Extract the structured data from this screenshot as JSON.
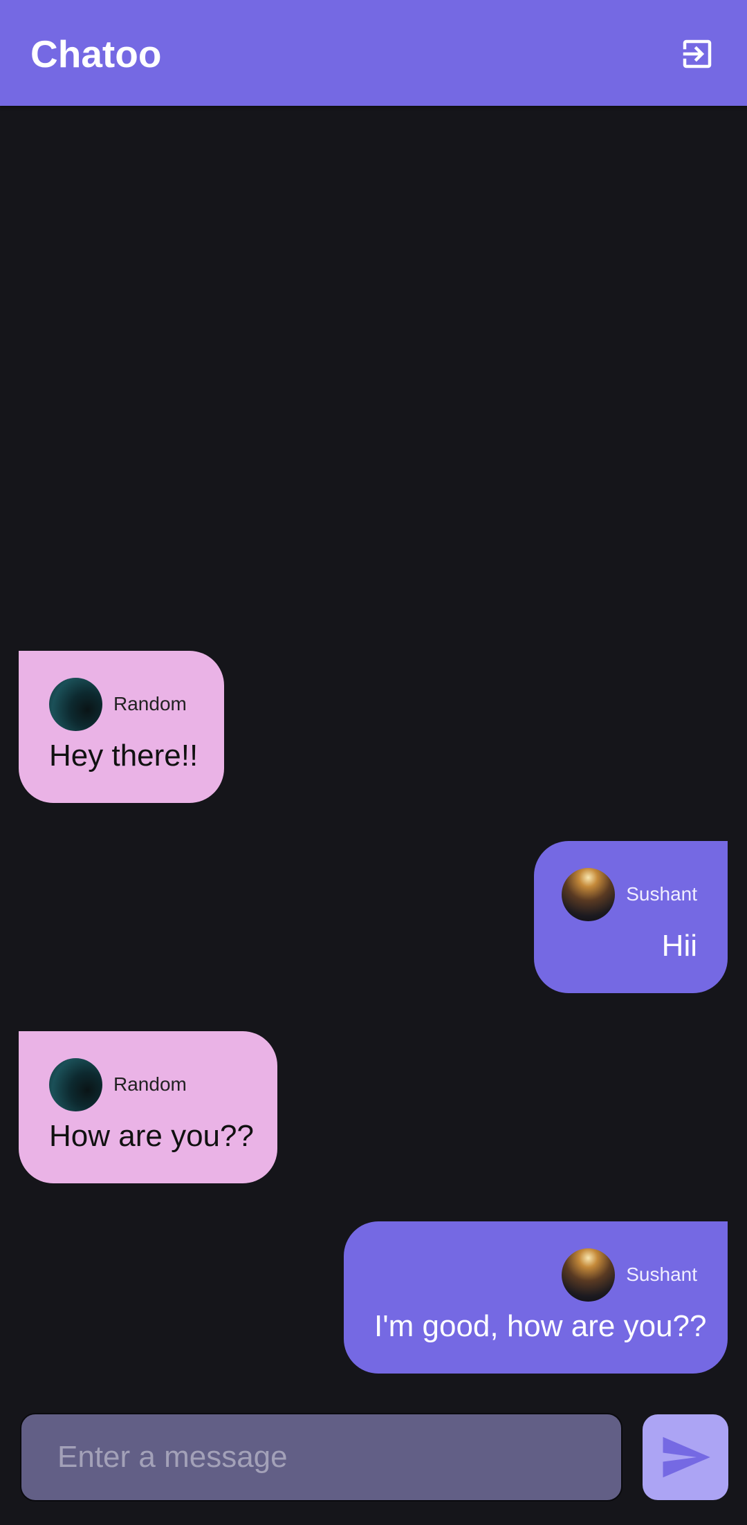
{
  "app_bar": {
    "title": "Chatoo",
    "logout_icon": "logout-icon"
  },
  "messages": [
    {
      "direction": "received",
      "sender": "Random",
      "text": "Hey there!!",
      "avatar": "random-avatar"
    },
    {
      "direction": "sent",
      "sender": "Sushant",
      "text": "Hii",
      "avatar": "sushant-avatar"
    },
    {
      "direction": "received",
      "sender": "Random",
      "text": "How are you??",
      "avatar": "random-avatar"
    },
    {
      "direction": "sent",
      "sender": "Sushant",
      "text": "I'm good, how are you??",
      "avatar": "sushant-avatar"
    }
  ],
  "composer": {
    "placeholder": "Enter a message",
    "value": "",
    "send_icon": "send-icon"
  },
  "colors": {
    "primary": "#7569e3",
    "background": "#15151a",
    "received_bubble": "#eab3e6",
    "input_field": "#625f86",
    "send_button": "#aca4f4"
  }
}
